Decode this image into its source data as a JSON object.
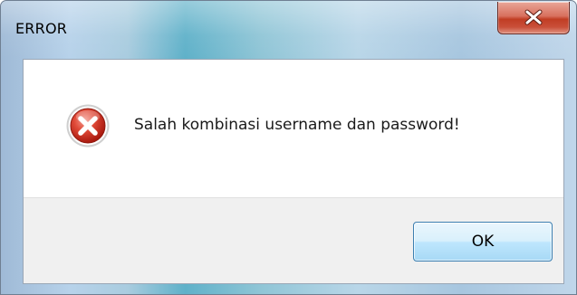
{
  "window": {
    "title": "ERROR"
  },
  "titlebar": {
    "close_icon": "close-icon"
  },
  "message": {
    "icon": "error-icon",
    "text": "Salah kombinasi username dan password!"
  },
  "buttons": {
    "ok_label": "OK"
  },
  "colors": {
    "close_button": "#c94a33",
    "error_icon": "#d53a2b",
    "ok_button_border": "#3c7fb1",
    "button_area": "#f0f0f0"
  }
}
